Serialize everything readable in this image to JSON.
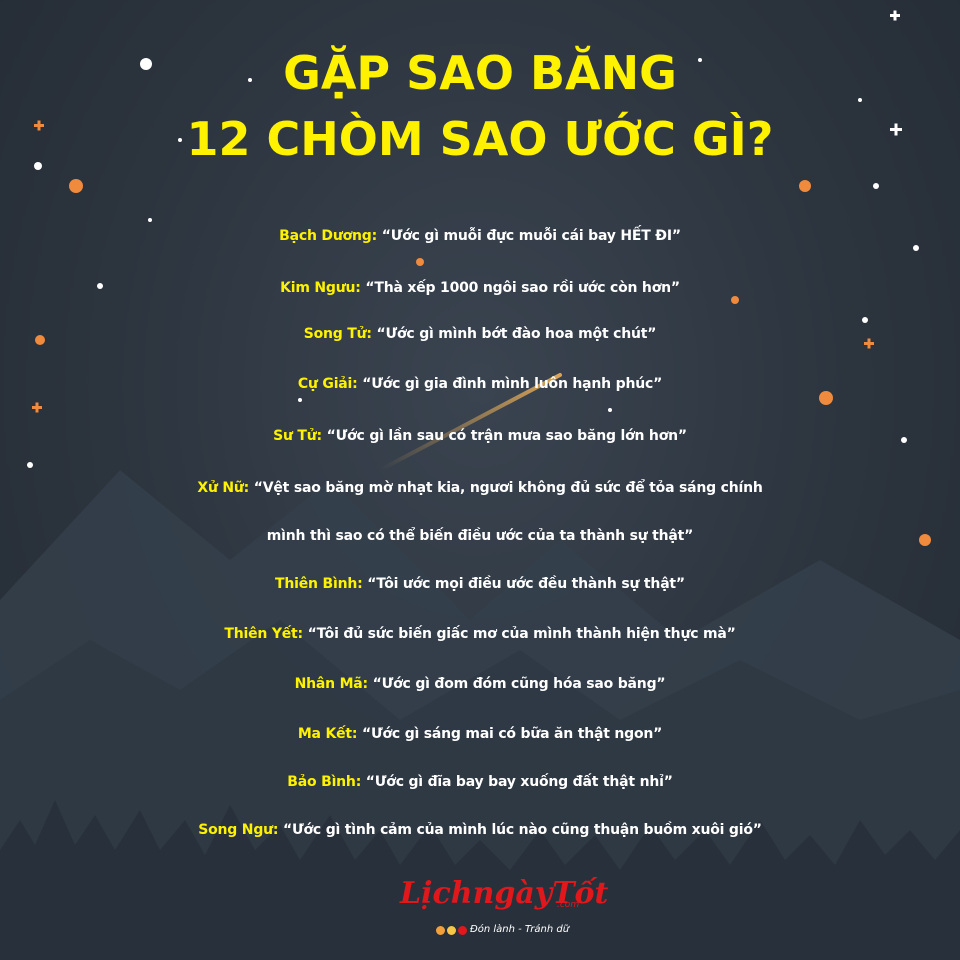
{
  "title": {
    "line1": "GẶP SAO BĂNG",
    "line2": "12 CHÒM SAO ƯỚC GÌ?"
  },
  "wishes": [
    {
      "sign": "Bạch Dương:",
      "text": "“Ước gì muỗi đực muỗi cái bay HẾT ĐI”"
    },
    {
      "sign": "Kim Ngưu:",
      "text": "“Thà xếp 1000 ngôi sao rồi ước còn hơn”"
    },
    {
      "sign": "Song Tử:",
      "text": "“Ước gì mình bớt đào hoa một chút”"
    },
    {
      "sign": "Cự Giải:",
      "text": "“Ước gì gia đình mình luôn hạnh phúc”"
    },
    {
      "sign": "Sư Tử:",
      "text": "“Ước gì lần sau có trận mưa sao băng lớn hơn”"
    },
    {
      "sign": "Xử Nữ:",
      "text": "“Vệt sao băng mờ nhạt kia, ngươi không đủ sức để tỏa sáng chính",
      "text2": "mình thì sao có thể biến điều ước của ta thành sự thật”"
    },
    {
      "sign": "Thiên Bình:",
      "text": "“Tôi ước mọi điều ước đều thành sự thật”"
    },
    {
      "sign": "Thiên Yết:",
      "text": "“Tôi đủ sức biến giấc mơ của mình thành hiện thực mà”"
    },
    {
      "sign": "Nhân Mã:",
      "text": "“Ước gì đom đóm cũng hóa sao băng”"
    },
    {
      "sign": "Ma Kết:",
      "text": "“Ước gì sáng mai có bữa ăn thật ngon”"
    },
    {
      "sign": "Bảo Bình:",
      "text": "“Ước gì đĩa bay bay xuống đất thật nhỉ”"
    },
    {
      "sign": "Song Ngư:",
      "text": "“Ước gì tình cảm của mình lúc nào cũng thuận buồm xuôi gió”"
    }
  ],
  "logo": {
    "main": "LịchngàyTốt",
    "tld": ".com",
    "slogan": "Đón lành - Tránh dữ"
  },
  "colors": {
    "background": "#2c343e",
    "title": "#fff200",
    "sign": "#fff200",
    "quote": "#ffffff",
    "star_orange": "#f08a3c",
    "mountain": "#3b4651",
    "logo_red": "#e0181c",
    "logo_dot_1": "#f2a03a",
    "logo_dot_2": "#f7c848",
    "logo_dot_3": "#e0181c"
  },
  "decor": {
    "background_icon": "night-sky-stars",
    "mountains_icon": "mountain-silhouette",
    "shooting_star_icon": "shooting-star",
    "logo_dots_icon": "three-dots"
  }
}
